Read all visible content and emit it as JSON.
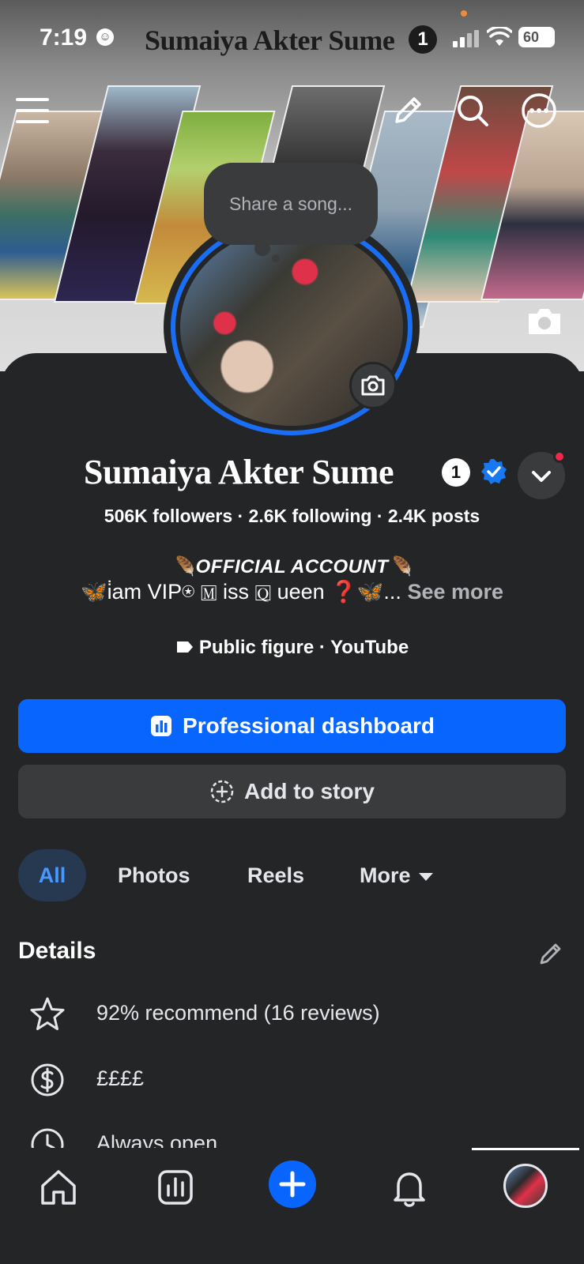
{
  "status_bar": {
    "time": "7:19",
    "title": "Sumaiya Akter Sume",
    "title_badge": "1",
    "battery": "60"
  },
  "cover": {
    "top_icons": [
      "menu-icon",
      "pencil-icon",
      "search-icon",
      "more-icon"
    ],
    "camera_icon": "camera-icon"
  },
  "song_bubble": {
    "text": "Share a song..."
  },
  "profile": {
    "name": "Sumaiya Akter Sume",
    "name_badge": "1",
    "verified": true,
    "stats": "506K followers · 2.6K following · 2.4K posts",
    "bio_line1": "🪶OFFICIAL ACCOUNT🪶",
    "bio_line2": "🦋i̇am VIP⍟ 🄼 iss 🅀 ueen ❓🦋...",
    "see_more": "See more",
    "category": "Public figure · YouTube"
  },
  "actions": {
    "primary": "Professional dashboard",
    "secondary": "Add to story"
  },
  "tabs": [
    {
      "label": "All",
      "active": true
    },
    {
      "label": "Photos",
      "active": false
    },
    {
      "label": "Reels",
      "active": false
    },
    {
      "label": "More",
      "active": false
    }
  ],
  "details": {
    "title": "Details",
    "rows": [
      {
        "icon": "star-icon",
        "text": "92% recommend (16 reviews)"
      },
      {
        "icon": "dollar-icon",
        "text": "££££"
      },
      {
        "icon": "clock-icon",
        "text": "Always open"
      }
    ]
  },
  "bottom_nav": [
    "home-icon",
    "dashboard-icon",
    "create-icon",
    "notifications-icon",
    "profile-avatar"
  ],
  "colors": {
    "accent": "#0866ff",
    "background": "#242526",
    "surface": "#3a3b3c",
    "active_tab_bg": "#263951",
    "active_tab_text": "#4599ff",
    "notification_dot": "#f02849"
  }
}
